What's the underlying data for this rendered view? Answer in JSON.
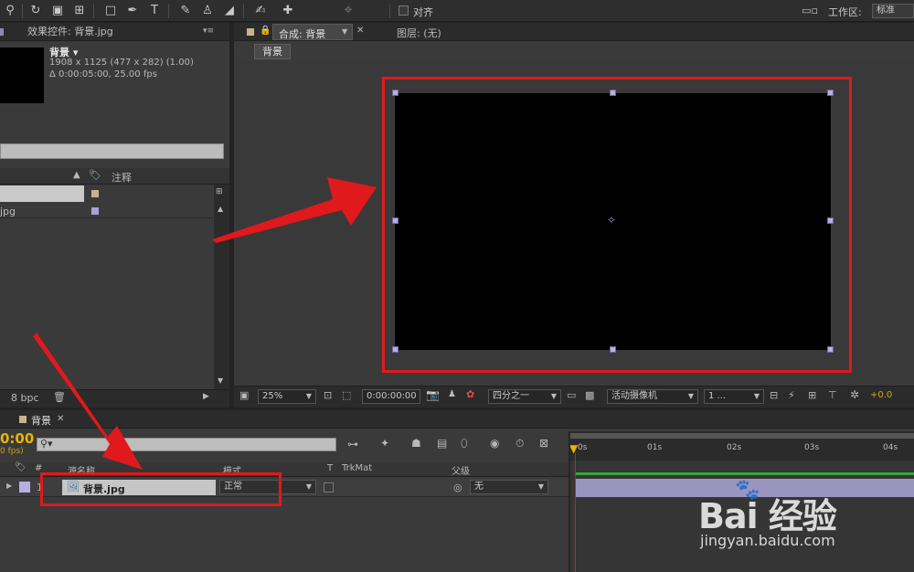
{
  "toolbar": {
    "align_label": "对齐",
    "workspace_label": "工作区:",
    "workspace_value": "标准"
  },
  "effect_panel": {
    "tab_title": "效果控件: 背景.jpg",
    "item_name": "背景 ▾",
    "dimensions": "1908 x 1125  (477 x 282) (1.00)",
    "duration": "Δ 0:00:05:00, 25.00 fps",
    "comment_header": "注释",
    "list_item_2": "jpg",
    "bpc_label": "8 bpc"
  },
  "comp_panel": {
    "tab_title": "合成: 背景",
    "layer_tab": "图层: (无)",
    "breadcrumb": "背景",
    "zoom": "25%",
    "timecode": "0:00:00:00",
    "resolution": "四分之一",
    "camera": "活动摄像机",
    "views": "1 ...",
    "exposure": "+0.0"
  },
  "timeline": {
    "tab_title": "背景",
    "timecode": "0:00",
    "fps": "0 fps)",
    "col_hash": "#",
    "col_source": "源名称",
    "col_mode": "模式",
    "col_t": "T",
    "col_trkmat": "TrkMat",
    "col_parent": "父级",
    "layer_number": "1",
    "layer_name": "背景.jpg",
    "layer_mode": "正常",
    "layer_parent": "无",
    "ruler": [
      "0s",
      "01s",
      "02s",
      "03s",
      "04s"
    ]
  },
  "watermark": {
    "brand": "Bai 经验",
    "url": "jingyan.baidu.com"
  },
  "colors": {
    "annotation": "#e0191c",
    "playhead": "#e8b400",
    "layer_bar": "#9a94c0",
    "work_area": "#2fa83a"
  }
}
